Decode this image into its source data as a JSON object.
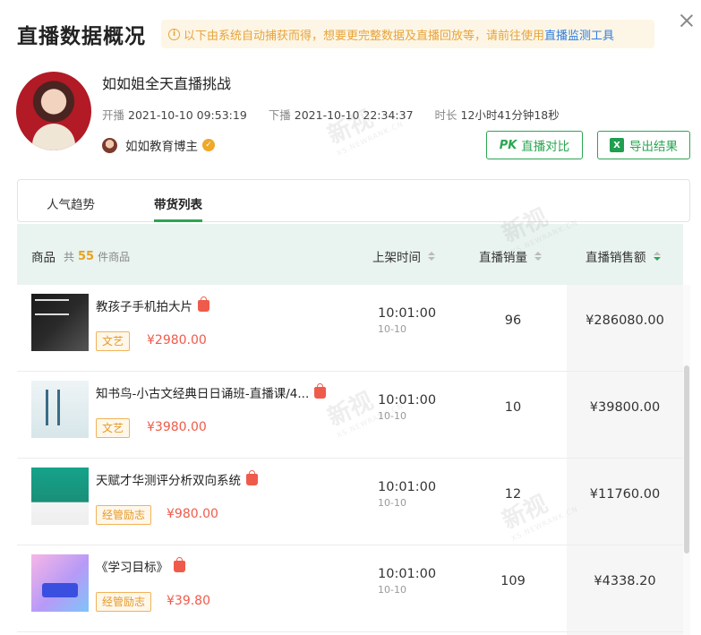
{
  "header": {
    "title": "直播数据概况",
    "notice_text": "以下由系统自动捕获而得，想要更完整数据及直播回放等，请前往使用",
    "notice_link": "直播监测工具",
    "notice_icon": "info-circle-icon",
    "close_icon": "close-icon"
  },
  "stream": {
    "title": "如如姐全天直播挑战",
    "start_label": "开播",
    "start_time": "2021-10-10 09:53:19",
    "end_label": "下播",
    "end_time": "2021-10-10 22:34:37",
    "duration_label": "时长",
    "duration": "12小时41分钟18秒",
    "host_name": "如如教育博主",
    "verified_icon": "verified-badge-icon"
  },
  "actions": {
    "compare_icon": "PK",
    "compare_label": "直播对比",
    "export_icon": "X",
    "export_label": "导出结果"
  },
  "tabs": [
    {
      "label": "人气趋势",
      "active": false
    },
    {
      "label": "带货列表",
      "active": true
    }
  ],
  "table": {
    "columns": {
      "goods": "商品",
      "count_prefix": "共",
      "count": "55",
      "count_suffix": "件商品",
      "time": "上架时间",
      "qty": "直播销量",
      "sales": "直播销售额"
    },
    "rows": [
      {
        "name": "教孩子手机拍大片",
        "tag": "文艺",
        "price": "¥2980.00",
        "time": "10:01:00",
        "date": "10-10",
        "qty": "96",
        "sales": "¥286080.00"
      },
      {
        "name": "知书鸟-小古文经典日日诵班-直播课/4...",
        "tag": "文艺",
        "price": "¥3980.00",
        "time": "10:01:00",
        "date": "10-10",
        "qty": "10",
        "sales": "¥39800.00"
      },
      {
        "name": "天赋才华测评分析双向系统",
        "tag": "经管励志",
        "price": "¥980.00",
        "time": "10:01:00",
        "date": "10-10",
        "qty": "12",
        "sales": "¥11760.00"
      },
      {
        "name": "《学习目标》",
        "tag": "经管励志",
        "price": "¥39.80",
        "time": "10:01:00",
        "date": "10-10",
        "qty": "109",
        "sales": "¥4338.20"
      }
    ]
  },
  "colors": {
    "accent": "#2aa651",
    "price": "#ef5b4b",
    "tag": "#e59a2a",
    "link": "#2e7fe0"
  },
  "watermark": {
    "text": "新视",
    "sub": "XS.NEWRANK.CN"
  }
}
